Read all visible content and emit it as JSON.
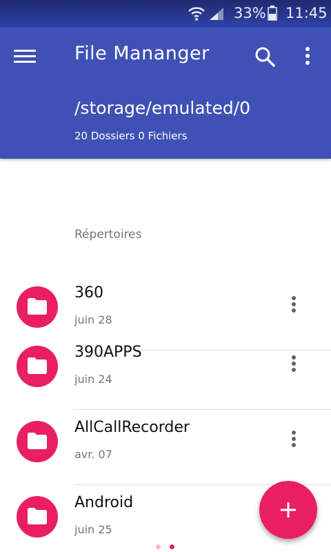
{
  "status_bar": {
    "battery_percent": "33%",
    "time": "11:45",
    "icons": [
      "wifi-icon",
      "signal-icon",
      "battery-icon"
    ]
  },
  "app_bar": {
    "title": "File Mananger",
    "path": "/storage/emulated/0",
    "counts": "20 Dossiers 0 Fichiers",
    "icons": [
      "menu-icon",
      "search-icon",
      "more-vert-icon"
    ]
  },
  "content": {
    "section_label": "Répertoires",
    "folders": [
      {
        "name": "360",
        "date": "juin 28"
      },
      {
        "name": "390APPS",
        "date": "juin 24"
      },
      {
        "name": "AllCallRecorder",
        "date": "avr. 07"
      },
      {
        "name": "Android",
        "date": "juin 25"
      }
    ]
  },
  "fab": {
    "icon": "plus-icon"
  },
  "pager": {
    "pages": 2,
    "active_index": 1
  },
  "colors": {
    "primary": "#3f51b5",
    "accent": "#e91e63",
    "status_bar_dark": "#1f2a6e",
    "secondary_text": "#757575"
  }
}
